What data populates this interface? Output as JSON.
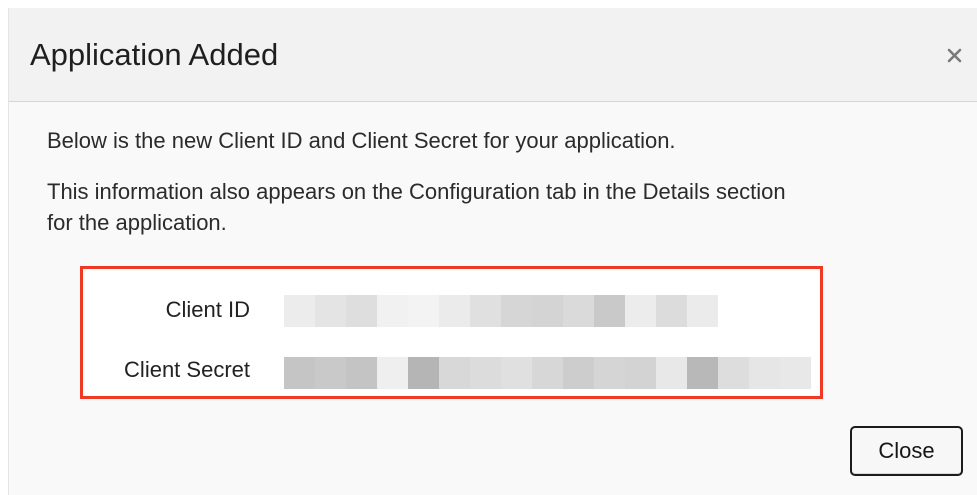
{
  "dialog": {
    "title": "Application Added",
    "close_icon": "close-icon",
    "line1": "Below is the new Client ID and Client Secret for your application.",
    "line2": "This information also appears on the Configuration tab in the Details section",
    "line3": "for the application.",
    "credentials": {
      "client_id_label": "Client ID",
      "client_secret_label": "Client Secret",
      "client_id_redacted_shades": [
        "#ececec",
        "#e4e4e4",
        "#dedede",
        "#f1f1f1",
        "#f3f3f3",
        "#ebebeb",
        "#e0e0e0",
        "#d6d6d6",
        "#d4d4d4",
        "#dadada",
        "#c9c9c9",
        "#ececec",
        "#dcdcdc",
        "#ebebeb"
      ],
      "client_secret_redacted_shades": [
        "#c5c5c5",
        "#c9c9c9",
        "#c4c4c4",
        "#efefef",
        "#b5b5b5",
        "#d8d8d8",
        "#dcdcdc",
        "#e0e0e0",
        "#d7d7d7",
        "#cdcdcd",
        "#d5d5d5",
        "#d3d3d3",
        "#e8e8e8",
        "#b8b8b8",
        "#dddddd",
        "#e6e6e6",
        "#e8e8e8"
      ],
      "highlight_color": "#ee3a25"
    },
    "close_button_label": "Close"
  }
}
